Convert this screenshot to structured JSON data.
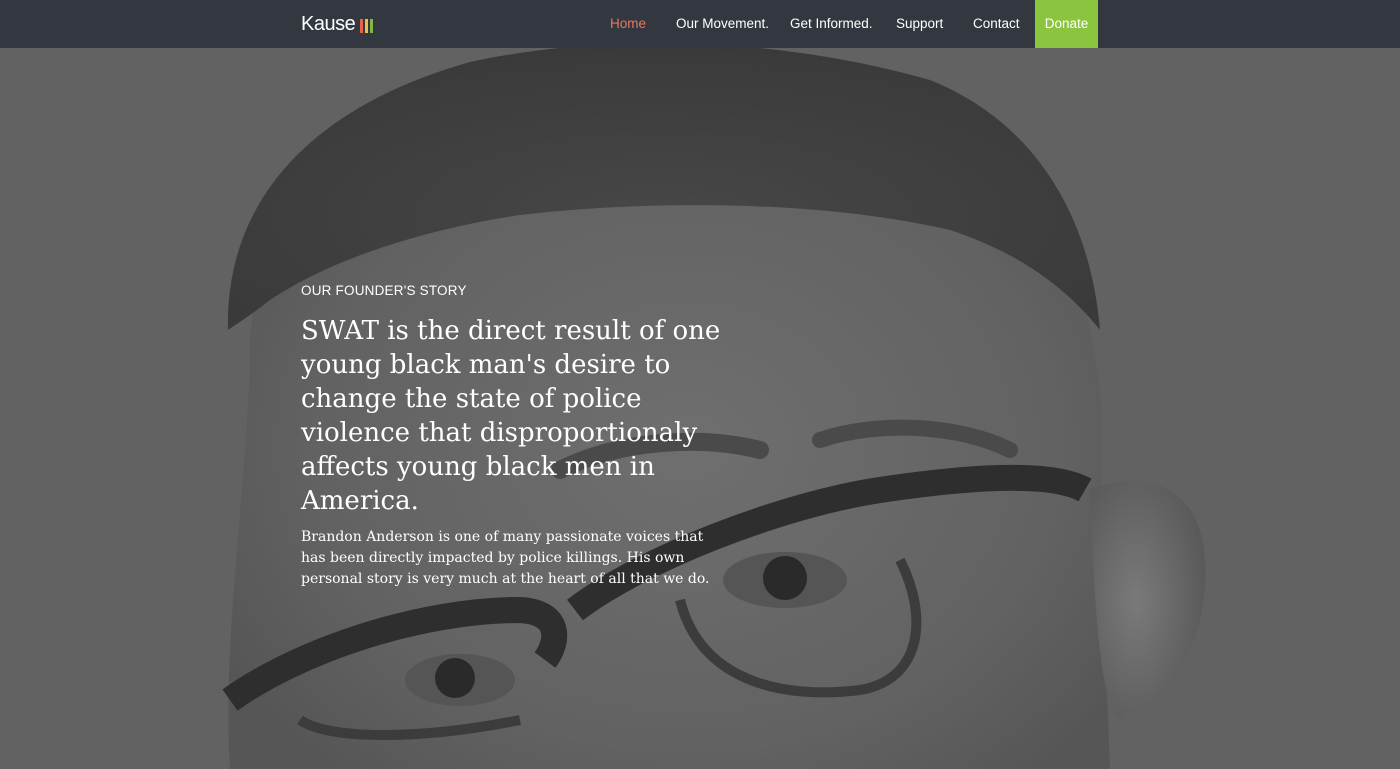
{
  "brand": {
    "name": "Kause",
    "bar_colors": [
      "#e7624a",
      "#e7c34a",
      "#7fba3d"
    ]
  },
  "nav": {
    "items": [
      {
        "label": "Home",
        "active": true
      },
      {
        "label": "Our Movement.",
        "active": false
      },
      {
        "label": "Get Informed.",
        "active": false
      },
      {
        "label": "Support",
        "active": false
      },
      {
        "label": "Contact",
        "active": false
      }
    ],
    "donate_label": "Donate"
  },
  "hero": {
    "eyebrow": "OUR FOUNDER'S STORY",
    "headline": "SWAT is the direct result of one young black man's desire to change the state of police violence that disproportionaly affects young black men in America.",
    "body": "Brandon Anderson is one of many passionate voices that has been directly impacted by police killings. His own personal story is very much at the heart of all that we do."
  },
  "colors": {
    "nav_background": "#333740",
    "nav_active": "#e8775f",
    "donate_background": "#8bc53f",
    "hero_overlay": "#616161",
    "text": "#ffffff"
  }
}
